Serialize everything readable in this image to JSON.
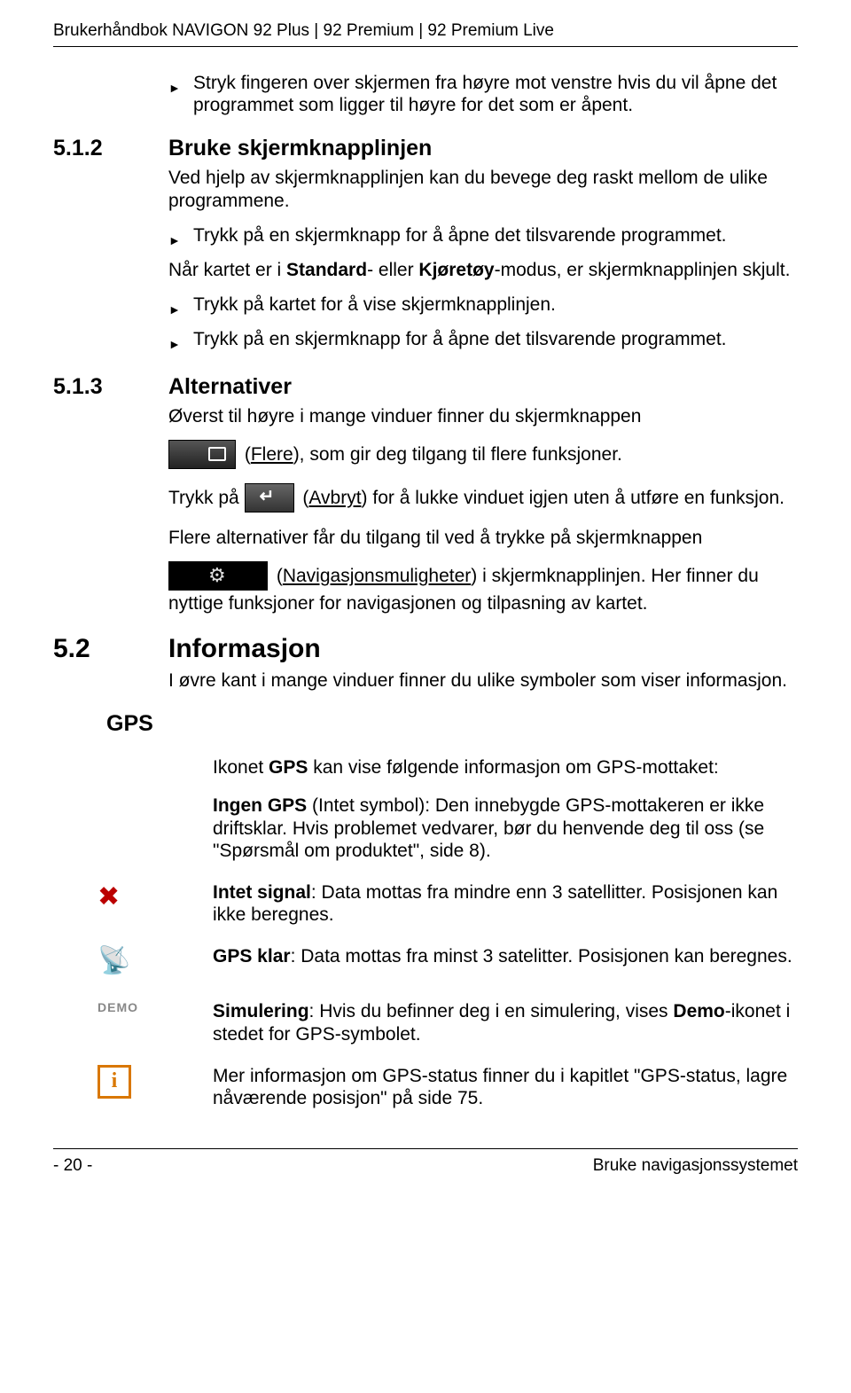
{
  "header": "Brukerhåndbok NAVIGON 92 Plus | 92 Premium | 92 Premium Live",
  "intro_bullet": "Stryk fingeren over skjermen fra høyre mot venstre hvis du vil åpne det programmet som ligger til høyre for det som er åpent.",
  "s512": {
    "num": "5.1.2",
    "title": "Bruke skjermknapplinjen",
    "p1": "Ved hjelp av skjermknapplinjen kan du bevege deg raskt mellom de ulike programmene.",
    "b1": "Trykk på en skjermknapp for å åpne det tilsvarende programmet.",
    "p2a": "Når kartet er i ",
    "p2b": "Standard",
    "p2c": "- eller ",
    "p2d": "Kjøretøy",
    "p2e": "-modus, er skjermknapplinjen skjult.",
    "b2": "Trykk på kartet for å vise skjermknapplinjen.",
    "b3": "Trykk på en skjermknapp for å åpne det tilsvarende programmet."
  },
  "s513": {
    "num": "5.1.3",
    "title": "Alternativer",
    "p1": "Øverst til høyre i mange vinduer finner du skjermknappen",
    "flere_label": "Flere",
    "p2_after": "), som gir deg tilgang til flere funksjoner.",
    "p3_before": "Trykk på ",
    "avbryt_label": "Avbryt",
    "p3_after": ") for å lukke vinduet igjen uten å utføre en funksjon.",
    "p4": "Flere alternativer får du tilgang til ved å trykke på skjermknappen",
    "nav_label": "Navigasjonsmuligheter",
    "p5_after": ") i skjermknapplinjen. Her finner du nyttige funksjoner for navigasjonen og tilpasning av kartet."
  },
  "s52": {
    "num": "5.2",
    "title": "Informasjon",
    "p1": "I øvre kant i mange vinduer finner du ulike symboler som viser informasjon."
  },
  "gps": {
    "heading": "GPS",
    "p1a": "Ikonet ",
    "p1b": "GPS",
    "p1c": " kan vise følgende informasjon om GPS-mottaket:",
    "p2a": "Ingen GPS",
    "p2b": " (Intet symbol): Den innebygde GPS-mottakeren er ikke driftsklar. Hvis problemet vedvarer, bør du henvende deg til oss (se \"Spørsmål om produktet\", side 8).",
    "p3a": "Intet signal",
    "p3b": ": Data mottas fra mindre enn 3 satellitter. Posisjonen kan ikke beregnes.",
    "p4a": "GPS klar",
    "p4b": ": Data mottas fra minst 3 satelitter. Posisjonen kan beregnes.",
    "p5a": "Simulering",
    "p5b": ": Hvis du befinner deg i en simulering, vises ",
    "p5c": "Demo",
    "p5d": "-ikonet i stedet for GPS-symbolet.",
    "p6": "Mer informasjon om GPS-status finner du i kapitlet \"GPS-status, lagre nåværende posisjon\" på side 75."
  },
  "footer": {
    "left": "- 20 -",
    "right": "Bruke navigasjonssystemet"
  }
}
